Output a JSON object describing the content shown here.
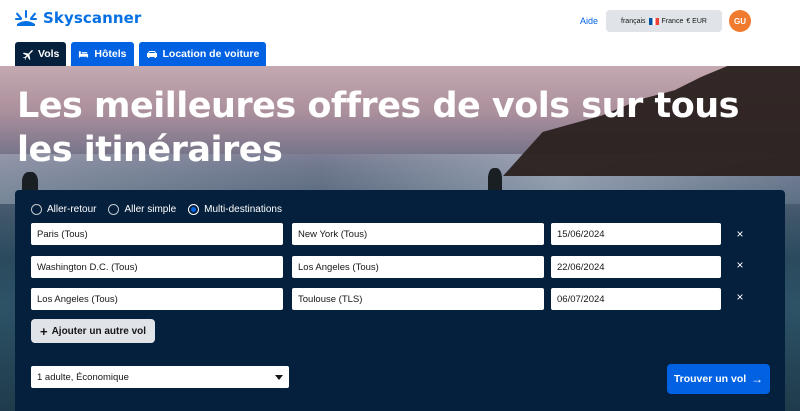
{
  "header": {
    "logo_text": "Skyscanner",
    "help_label": "Aide",
    "locale": {
      "language": "français",
      "country": "France",
      "currency": "€ EUR"
    },
    "avatar_initials": "GU"
  },
  "tabs": [
    {
      "label": "Vols",
      "icon": "plane-icon",
      "active": true
    },
    {
      "label": "Hôtels",
      "icon": "bed-icon",
      "active": false
    },
    {
      "label": "Location de voiture",
      "icon": "car-icon",
      "active": false
    }
  ],
  "hero": {
    "title": "Les meilleures offres de vols sur tous les itinéraires"
  },
  "search": {
    "trip_types": [
      {
        "label": "Aller-retour",
        "selected": false
      },
      {
        "label": "Aller simple",
        "selected": false
      },
      {
        "label": "Multi-destinations",
        "selected": true
      }
    ],
    "legs": [
      {
        "from": "Paris (Tous)",
        "to": "New York (Tous)",
        "date": "15/06/2024"
      },
      {
        "from": "Washington D.C. (Tous)",
        "to": "Los Angeles (Tous)",
        "date": "22/06/2024"
      },
      {
        "from": "Los Angeles (Tous)",
        "to": "Toulouse (TLS)",
        "date": "06/07/2024"
      }
    ],
    "remove_icon": "×",
    "add_flight_label": "Ajouter un autre vol",
    "add_icon": "+",
    "travellers_value": "1 adulte, Économique",
    "search_button_label": "Trouver un vol",
    "search_button_arrow": "→"
  },
  "colors": {
    "brand": "#0770e3",
    "primary": "#0062e3",
    "panel": "#05203c",
    "avatar": "#f07a2d"
  }
}
